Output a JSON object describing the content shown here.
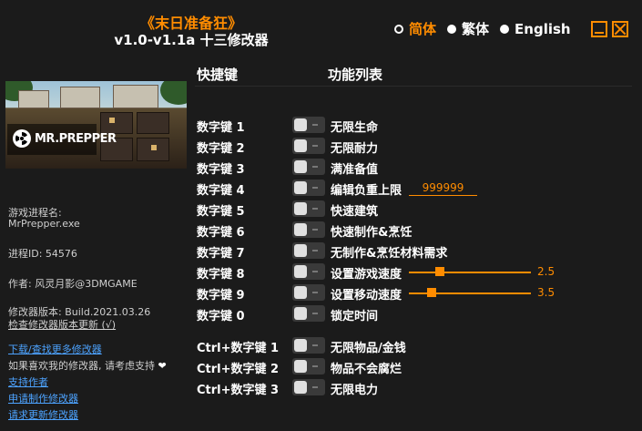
{
  "header": {
    "game_title": "《末日准备狂》",
    "version": "v1.0-v1.1a 十三修改器"
  },
  "languages": [
    {
      "label": "简体",
      "selected": true
    },
    {
      "label": "繁体",
      "selected": false
    },
    {
      "label": "English",
      "selected": false
    }
  ],
  "banner": {
    "logo_text": "MR.PREPPER",
    "icon": "radiation-icon"
  },
  "info": {
    "process_label": "游戏进程名:",
    "process_name": "MrPrepper.exe",
    "pid": "进程ID: 54576",
    "author": "作者: 风灵月影@3DMGAME",
    "trainer_version": "修改器版本: Build.2021.03.26",
    "check_update": "检查修改器版本更新 (√)"
  },
  "links": {
    "download_more": "下载/查找更多修改器",
    "support_text": "如果喜欢我的修改器, 请考虑支持",
    "support_author": "支持作者",
    "request_trainer": "申请制作修改器",
    "request_update": "请求更新修改器"
  },
  "table": {
    "hotkey_header": "快捷键",
    "features_header": "功能列表",
    "rows": [
      {
        "key": "数字键 1",
        "name": "无限生命"
      },
      {
        "key": "数字键 2",
        "name": "无限耐力"
      },
      {
        "key": "数字键 3",
        "name": "满准备值"
      },
      {
        "key": "数字键 4",
        "name": "编辑负重上限",
        "input_value": "999999"
      },
      {
        "key": "数字键 5",
        "name": "快速建筑"
      },
      {
        "key": "数字键 6",
        "name": "快速制作&烹饪"
      },
      {
        "key": "数字键 7",
        "name": "无制作&烹饪材料需求"
      },
      {
        "key": "数字键 8",
        "name": "设置游戏速度",
        "slider_value": "2.5",
        "slider_fraction": 0.25
      },
      {
        "key": "数字键 9",
        "name": "设置移动速度",
        "slider_value": "3.5",
        "slider_fraction": 0.19
      },
      {
        "key": "数字键 0",
        "name": "锁定时间"
      },
      {
        "key": "Ctrl+数字键 1",
        "name": "无限物品/金钱"
      },
      {
        "key": "Ctrl+数字键 2",
        "name": "物品不会腐烂"
      },
      {
        "key": "Ctrl+数字键 3",
        "name": "无限电力"
      }
    ]
  },
  "colors": {
    "accent": "#ff8c00",
    "background": "#1b1b1b",
    "link": "#4da3ff"
  }
}
